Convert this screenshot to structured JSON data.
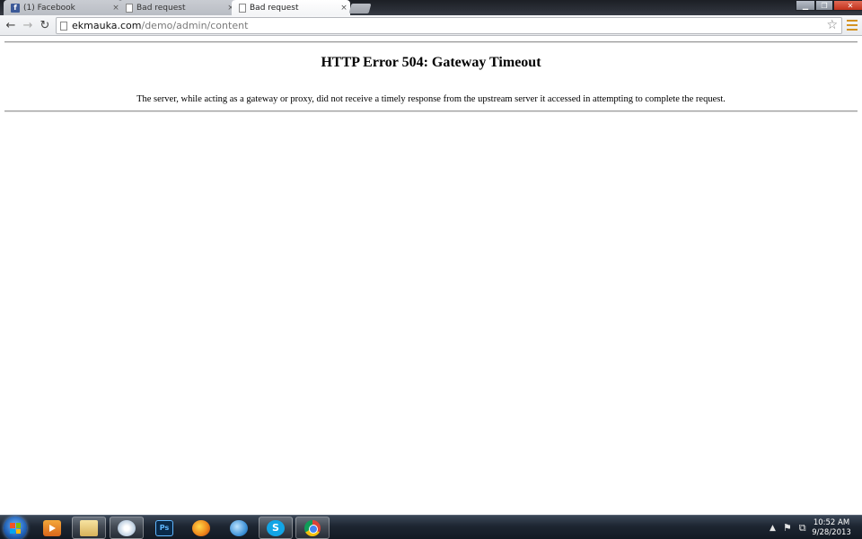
{
  "browser": {
    "tabs": [
      {
        "title": "(1) Facebook",
        "icon": "facebook-icon",
        "active": false
      },
      {
        "title": "Bad request",
        "icon": "page-icon",
        "active": false
      },
      {
        "title": "Bad request",
        "icon": "page-icon",
        "active": true
      }
    ],
    "tab_close_glyph": "×",
    "address": {
      "host": "ekmauka.com",
      "path": "/demo/admin/content"
    }
  },
  "page": {
    "heading": "HTTP Error 504: Gateway Timeout",
    "message": "The server, while acting as a gateway or proxy, did not receive a timely response from the upstream server it accessed in attempting to complete the request."
  },
  "taskbar": {
    "pinned": [
      {
        "name": "media-player-icon",
        "label": ""
      },
      {
        "name": "folder-icon",
        "label": ""
      },
      {
        "name": "paint-icon",
        "label": ""
      },
      {
        "name": "photoshop-icon",
        "label": "Ps"
      },
      {
        "name": "firefox-icon",
        "label": ""
      },
      {
        "name": "search-icon",
        "label": ""
      },
      {
        "name": "skype-icon",
        "label": "S"
      },
      {
        "name": "chrome-icon",
        "label": ""
      }
    ],
    "clock": {
      "time": "10:52 AM",
      "date": "9/28/2013"
    }
  },
  "colors": {
    "menu_accent": "#d49322",
    "close_button": "#c2321c",
    "facebook_blue": "#3b5998"
  }
}
